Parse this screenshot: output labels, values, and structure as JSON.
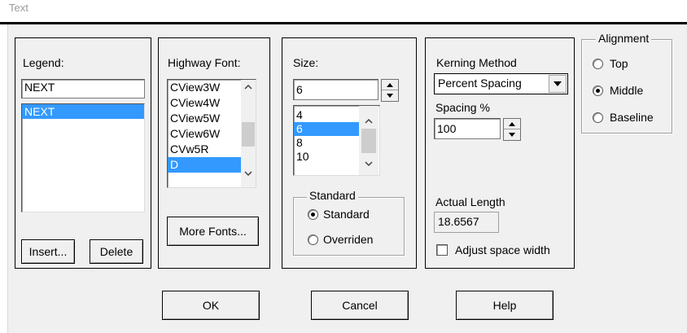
{
  "window": {
    "title": "Text"
  },
  "legend": {
    "label": "Legend:",
    "value": "NEXT",
    "items": [
      "NEXT"
    ],
    "insert_button": "Insert...",
    "delete_button": "Delete"
  },
  "highway_font": {
    "label": "Highway Font:",
    "items": [
      "CView3W",
      "CView4W",
      "CView5W",
      "CView6W",
      "CVw5R",
      "D"
    ],
    "selected": "D",
    "more_fonts_button": "More Fonts..."
  },
  "size": {
    "label": "Size:",
    "value": "6",
    "items": [
      "4",
      "6",
      "8",
      "10"
    ],
    "selected": "6",
    "standard_group": {
      "title": "Standard",
      "options": [
        "Standard",
        "Overriden"
      ],
      "selected": "Standard"
    }
  },
  "kerning": {
    "label": "Kerning Method",
    "method": "Percent Spacing",
    "spacing_label": "Spacing %",
    "spacing_value": "100",
    "actual_length_label": "Actual Length",
    "actual_length_value": "18.6567",
    "adjust_label": "Adjust space width",
    "adjust_checked": false
  },
  "alignment": {
    "title": "Alignment",
    "options": [
      "Top",
      "Middle",
      "Baseline"
    ],
    "selected": "Middle"
  },
  "buttons": {
    "ok": "OK",
    "cancel": "Cancel",
    "help": "Help"
  },
  "icons": {
    "scroll_up": "triangle-up",
    "scroll_down": "triangle-down",
    "spin_up": "triangle-up",
    "spin_down": "triangle-down",
    "dropdown": "triangle-down"
  },
  "colors": {
    "selection": "#3399ff",
    "background": "#f0f0f0"
  }
}
